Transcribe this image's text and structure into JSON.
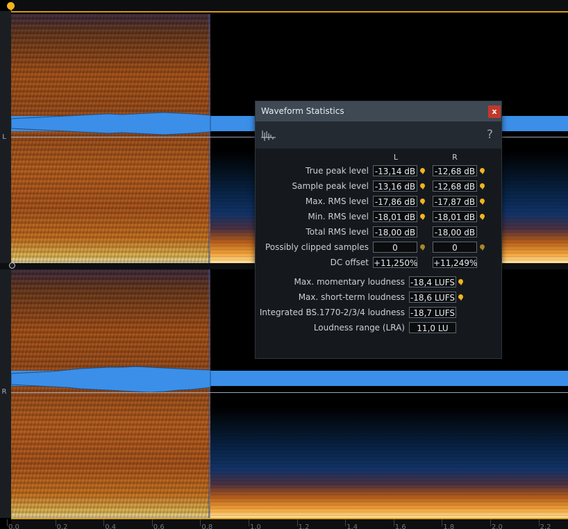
{
  "channels": {
    "left": "L",
    "right": "R"
  },
  "timeline": {
    "ticks": [
      "0.0",
      "0.2",
      "0.4",
      "0.6",
      "0.8",
      "1.0",
      "1.2",
      "1.4",
      "1.6",
      "1.8",
      "2.0",
      "2.2"
    ]
  },
  "dialog": {
    "title": "Waveform Statistics",
    "close_label": "x",
    "help_label": "?",
    "col_l": "L",
    "col_r": "R",
    "rows": [
      {
        "label": "True peak level",
        "l": "-13,14 dB",
        "r": "-12,68 dB"
      },
      {
        "label": "Sample peak level",
        "l": "-13,16 dB",
        "r": "-12,68 dB"
      },
      {
        "label": "Max. RMS level",
        "l": "-17,86 dB",
        "r": "-17,87 dB"
      },
      {
        "label": "Min. RMS level",
        "l": "-18,01 dB",
        "r": "-18,01 dB"
      },
      {
        "label": "Total RMS level",
        "l": "-18,00 dB",
        "r": "-18,00 dB"
      },
      {
        "label": "Possibly clipped samples",
        "l": "0",
        "r": "0"
      },
      {
        "label": "DC offset",
        "l": "+11,250%",
        "r": "+11,249%"
      }
    ],
    "loudness": [
      {
        "label": "Max. momentary loudness",
        "value": "-18,4 LUFS"
      },
      {
        "label": "Max. short-term loudness",
        "value": "-18,6 LUFS"
      },
      {
        "label": "Integrated BS.1770-2/3/4 loudness",
        "value": "-18,7 LUFS"
      },
      {
        "label": "Loudness range (LRA)",
        "value": "11,0 LU"
      }
    ]
  },
  "colors": {
    "accent": "#f0b41e",
    "waveform": "#3b8fe8",
    "close": "#c0392b"
  }
}
